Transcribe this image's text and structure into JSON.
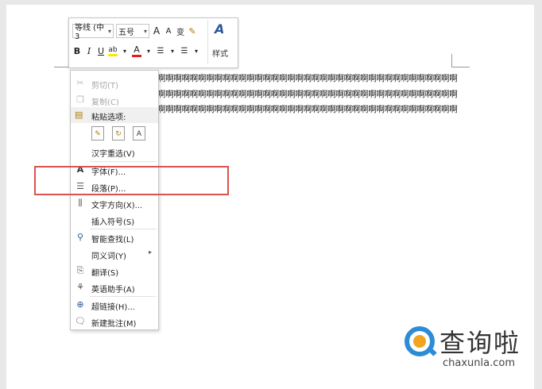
{
  "toolbar": {
    "font_name": "等线 (中3",
    "font_size": "五号",
    "grow_font": "A",
    "shrink_font": "A",
    "phonetic": "变",
    "bold": "B",
    "italic": "I",
    "underline": "U",
    "highlight": "ab",
    "font_color": "A",
    "styles_label": "样式",
    "dropdown_arrow": "▾"
  },
  "document": {
    "text": "啊啊啊啊啊啊啊啊啊啊啊啊啊啊啊啊啊啊啊啊啊啊啊啊啊啊啊啊啊啊啊啊啊啊啊啊啊啊啊啊啊啊啊啊啊啊啊啊啊啊啊啊啊啊啊啊啊啊啊啊啊啊啊啊啊啊啊啊啊啊啊啊啊啊啊啊啊啊啊啊啊啊啊啊啊啊啊啊啊啊啊啊啊啊啊啊啊啊啊啊啊啊啊啊啊啊啊啊啊啊啊啊啊啊啊啊啊啊啊啊啊啊啊啊啊啊啊啊啊啊啊啊啊啊啊啊啊啊啊啊啊啊↵"
  },
  "context_menu": {
    "cut": "剪切(T)",
    "copy": "复制(C)",
    "paste_options": "粘贴选项:",
    "reconvert": "汉字重选(V)",
    "font": "字体(F)...",
    "paragraph": "段落(P)...",
    "text_direction": "文字方向(X)...",
    "insert_symbol": "插入符号(S)",
    "smart_lookup": "智能查找(L)",
    "synonyms": "同义词(Y)",
    "translate": "翻译(S)",
    "english_assistant": "英语助手(A)",
    "hyperlink": "超链接(H)...",
    "new_comment": "新建批注(M)",
    "submenu_arrow": "▸"
  },
  "watermark": {
    "name_cn": "查询啦",
    "domain": "chaxunla.com"
  },
  "colors": {
    "highlight_box": "#d9534f",
    "logo_blue": "#2c8cd6",
    "logo_orange": "#f0a520"
  }
}
